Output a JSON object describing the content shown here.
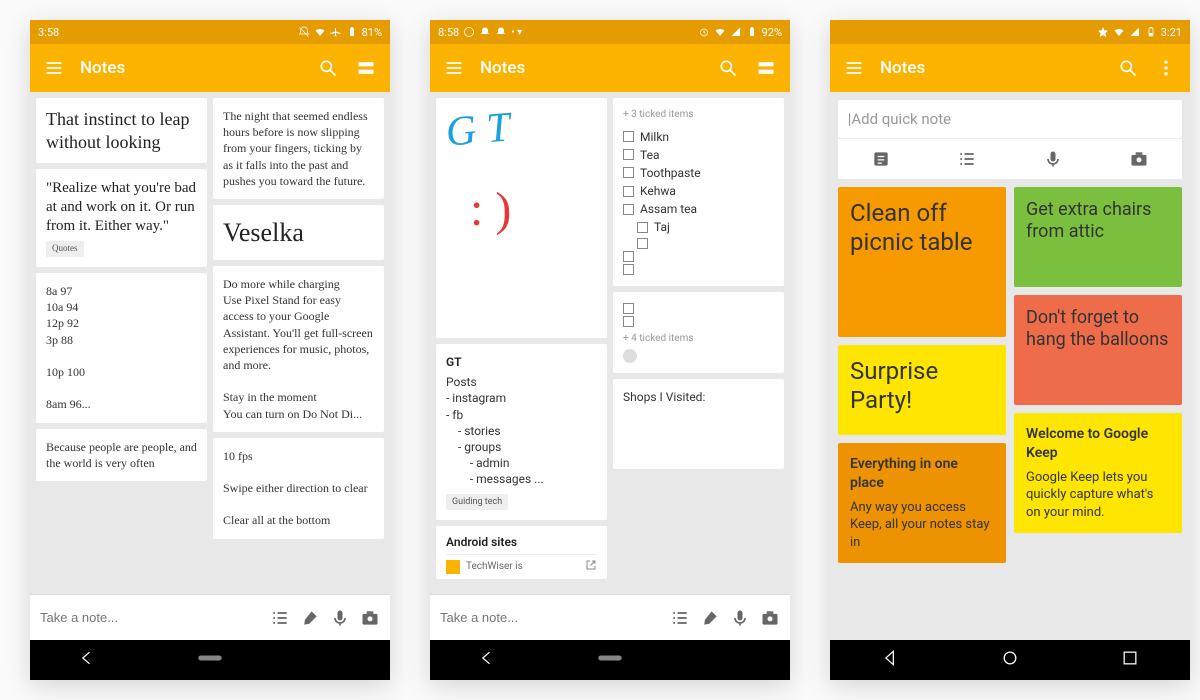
{
  "phones": [
    {
      "status": {
        "time": "3:58",
        "battery": "81%"
      },
      "appbar": {
        "title": "Notes"
      },
      "bottombar": {
        "placeholder": "Take a note..."
      },
      "left": [
        {
          "kind": "big",
          "text": "That instinct to leap\nwithout looking"
        },
        {
          "kind": "bigquote",
          "text": "\"Realize what you're bad at and work on it. Or run from it. Either way.\"",
          "tag": "Quotes"
        },
        {
          "kind": "plain",
          "text": "8a 97\n10a 94\n12p 92\n3p 88\n\n10p 100\n\n8am 96..."
        },
        {
          "kind": "plain",
          "text": "Because people are people, and the world is very often"
        }
      ],
      "right": [
        {
          "kind": "plain",
          "text": "The night that seemed endless hours before is now slipping from your fingers, ticking by as it falls into the past and pushes you toward the future."
        },
        {
          "kind": "veselka",
          "text": "Veselka"
        },
        {
          "kind": "plain",
          "text": "Do more while charging\nUse Pixel Stand for easy access to your Google Assistant. You'll get full-screen experiences for music, photos, and more.\n\nStay in the moment\nYou can turn on Do Not Di..."
        },
        {
          "kind": "plain",
          "text": "10 fps\n\nSwipe either direction to clear\n\nClear all at the bottom"
        }
      ]
    },
    {
      "status": {
        "time": "8:58",
        "battery": "92%"
      },
      "appbar": {
        "title": "Notes"
      },
      "bottombar": {
        "placeholder": "Take a note..."
      },
      "left": [
        {
          "kind": "drawing",
          "sig": "G T",
          "smile": ": )"
        },
        {
          "kind": "gt",
          "title": "GT",
          "body": "Posts\n- instagram\n- fb\n    - stories\n    - groups\n        - admin\n        - messages ...",
          "tag": "Guiding tech"
        },
        {
          "kind": "titleonly",
          "title": "Android sites",
          "sub": "TechWiser is"
        }
      ],
      "right": [
        {
          "kind": "checklist",
          "header": "+ 3 ticked items",
          "items": [
            {
              "label": "Milkn",
              "sub": false
            },
            {
              "label": "Tea",
              "sub": false
            },
            {
              "label": "Toothpaste",
              "sub": false
            },
            {
              "label": "Kehwa",
              "sub": false
            },
            {
              "label": "Assam tea",
              "sub": false
            },
            {
              "label": "Taj",
              "sub": true
            },
            {
              "label": "",
              "sub": true
            },
            {
              "label": "",
              "sub": false
            },
            {
              "label": "",
              "sub": false
            }
          ]
        },
        {
          "kind": "checklist2",
          "items": [
            {
              "label": ""
            },
            {
              "label": ""
            }
          ],
          "footer": "+ 4 ticked items",
          "avatar": true
        },
        {
          "kind": "plain",
          "text": "Shops I Visited:"
        }
      ]
    },
    {
      "status": {
        "time": "3:21"
      },
      "appbar": {
        "title": "Notes"
      },
      "quickadd": {
        "placeholder": "Add quick note"
      },
      "left": [
        {
          "bg": "#f79a00",
          "text": "Clean off picnic table",
          "style": "large"
        },
        {
          "bg": "#ffe600",
          "text": "Surprise Party!",
          "style": "large"
        },
        {
          "bg": "#ed9200",
          "title": "Everything in one place",
          "text": "Any way you access Keep, all your notes stay in",
          "style": "small"
        }
      ],
      "right": [
        {
          "bg": "#7bbf3f",
          "text": "Get extra chairs from attic",
          "style": "med"
        },
        {
          "bg": "#ef6c4a",
          "text": "Don't forget to hang the balloons",
          "style": "med"
        },
        {
          "bg": "#ffe600",
          "title": "Welcome to Google Keep",
          "text": "Google Keep lets you quickly capture what's on your mind.",
          "style": "small"
        }
      ]
    }
  ],
  "icons": {
    "menu": "menu-icon",
    "search": "search-icon",
    "view": "view-icon",
    "overflow": "overflow-icon",
    "list": "list-icon",
    "brush": "brush-icon",
    "mic": "mic-icon",
    "camera": "camera-icon",
    "back": "back-icon",
    "home": "home-icon",
    "recent": "recent-icon",
    "text": "text-icon"
  }
}
